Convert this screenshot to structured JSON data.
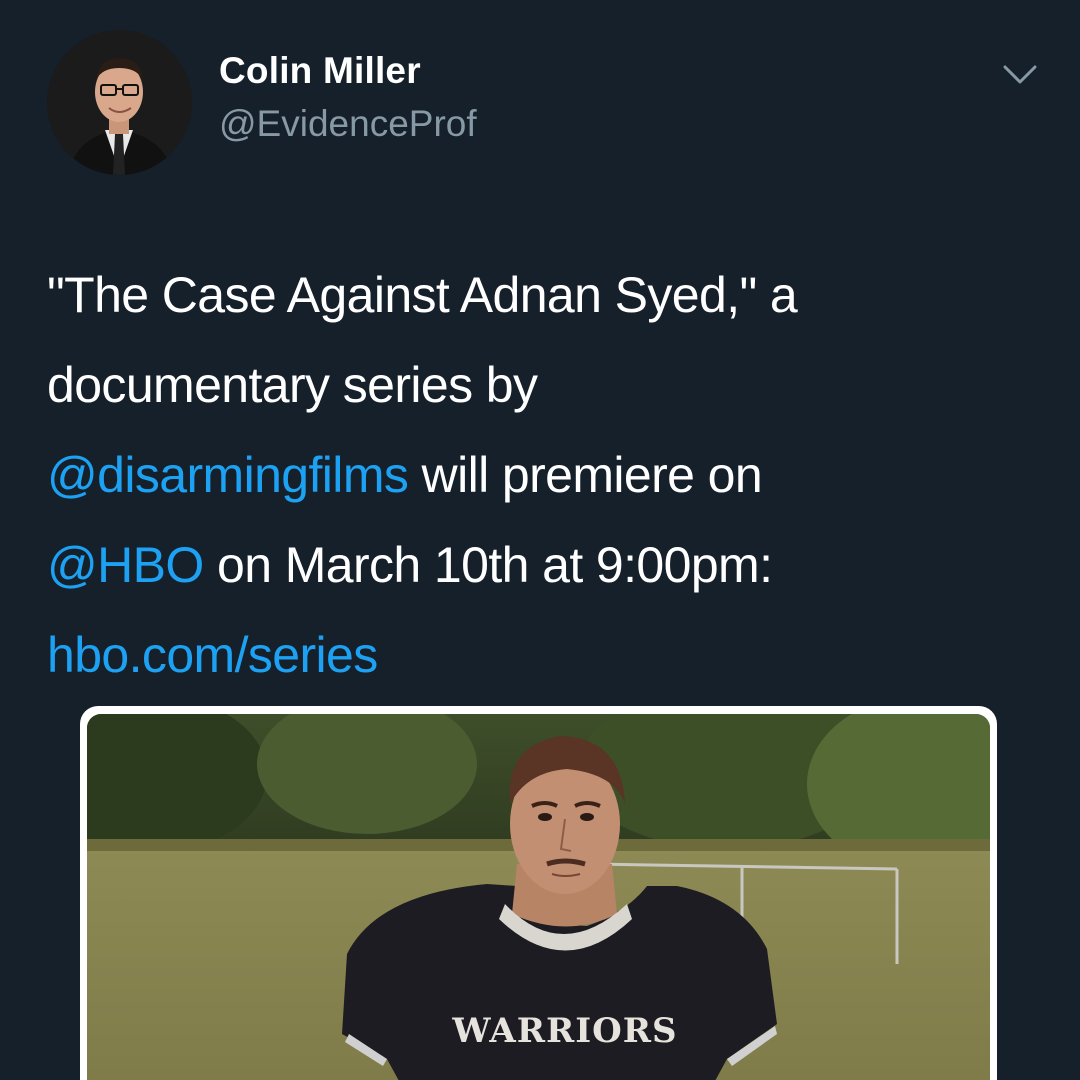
{
  "author": {
    "display_name": "Colin Miller",
    "handle": "@EvidenceProf"
  },
  "tweet": {
    "line1_text": "\"The Case Against Adnan Syed,\" a",
    "line2_text": "documentary series by",
    "line3_mention": "@disarmingfilms",
    "line3_text": " will premiere on",
    "line4_mention": "@HBO",
    "line4_text": " on March 10th at 9:00pm:",
    "line5_link": "hbo.com/series"
  },
  "media": {
    "jersey_text": "WARRIORS"
  },
  "icons": {
    "menu": "chevron-down-icon"
  },
  "colors": {
    "background": "#15202b",
    "text": "#ffffff",
    "secondary_text": "#8899a6",
    "link": "#1da1f2"
  }
}
